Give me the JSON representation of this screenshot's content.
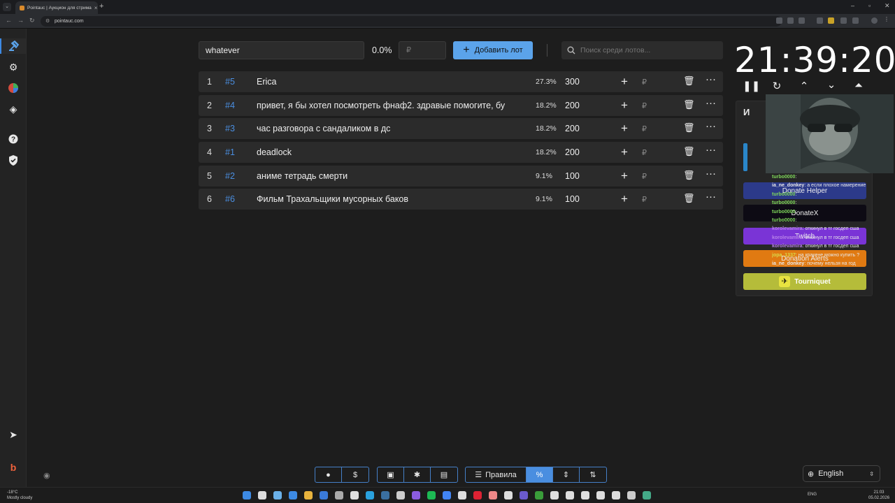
{
  "browser": {
    "tab_title": "Pointauc | Аукцион для стрима",
    "url": "pointauc.com"
  },
  "colors": {
    "accent": "#5ba3ea",
    "id_link": "#4a8ee0",
    "background": "#1d1d1d",
    "row_background": "#2b2b2b"
  },
  "sidebar": {
    "items": [
      {
        "name": "auction-icon"
      },
      {
        "name": "settings-icon"
      },
      {
        "name": "wheel-icon"
      },
      {
        "name": "layers-icon"
      },
      {
        "name": "help-icon"
      },
      {
        "name": "shield-check-icon"
      },
      {
        "name": "telegram-icon"
      },
      {
        "name": "boosty-icon"
      }
    ]
  },
  "lot_form": {
    "name_value": "whatever",
    "percent": "0.0%",
    "amount_placeholder": "₽",
    "add_button_label": "Добавить лот",
    "search_placeholder": "Поиск среди лотов..."
  },
  "lots": [
    {
      "index": "1",
      "id": "#5",
      "name": "Erica",
      "percent": "27.3%",
      "amount": "300",
      "currency": "₽"
    },
    {
      "index": "2",
      "id": "#4",
      "name": "привет, я бы хотел посмотреть фнаф2. здравые помогите, бу",
      "percent": "18.2%",
      "amount": "200",
      "currency": "₽"
    },
    {
      "index": "3",
      "id": "#3",
      "name": "час разговора с сандаликом в дс",
      "percent": "18.2%",
      "amount": "200",
      "currency": "₽"
    },
    {
      "index": "4",
      "id": "#1",
      "name": "deadlock",
      "percent": "18.2%",
      "amount": "200",
      "currency": "₽"
    },
    {
      "index": "5",
      "id": "#2",
      "name": "аниме тетрадь смерти",
      "percent": "9.1%",
      "amount": "100",
      "currency": "₽"
    },
    {
      "index": "6",
      "id": "#6",
      "name": "Фильм Трахальщики мусорных баков",
      "percent": "9.1%",
      "amount": "100",
      "currency": "₽"
    }
  ],
  "timer": {
    "display": "21:39:20"
  },
  "integrations": {
    "header_letter": "И",
    "buttons": [
      {
        "label": "Donate Helper",
        "color": "#2c3a8a"
      },
      {
        "label": "DonateX",
        "color": "#0d0b14"
      },
      {
        "label": "Twitch",
        "color": "#7a34d6"
      },
      {
        "label": "Donation Alerts",
        "color": "#e07a12"
      },
      {
        "label": "Tourniquet",
        "color": "#b5bc3a"
      }
    ]
  },
  "chat": [
    {
      "user": "turbo0000",
      "text": "",
      "color": "#7fd85b"
    },
    {
      "user": "ia_ne_donkey",
      "text": "а если плохое намерение",
      "color": "#e8e8e8"
    },
    {
      "user": "turbo0000",
      "text": "",
      "color": "#7fd85b"
    },
    {
      "user": "turbo0000",
      "text": "",
      "color": "#7fd85b"
    },
    {
      "user": "turbo0000",
      "text": "",
      "color": "#7fd85b"
    },
    {
      "user": "turbo0000",
      "text": "",
      "color": "#7fd85b"
    },
    {
      "user": "korolevamira",
      "text": "откинул в тг госдеп сша",
      "color": "#b783e8"
    },
    {
      "user": "korolevamira",
      "text": "откинул в тг госдеп сша",
      "color": "#b783e8"
    },
    {
      "user": "korolevamira",
      "text": "откинул в тг госдеп сша",
      "color": "#b783e8"
    },
    {
      "user": "jopa_1337",
      "text": "на кракене можно купить ?",
      "color": "#d8d84a"
    },
    {
      "user": "ia_ne_donkey",
      "text": "почему нельзя на год",
      "color": "#e8e8e8"
    }
  ],
  "bottom_toolbar": {
    "rules_label": "Правила"
  },
  "language": {
    "selected": "English"
  },
  "taskbar": {
    "temperature": "-18°C",
    "weather": "Mostly cloudy",
    "keyboard_lang": "ENG",
    "time": "21:03",
    "date": "05.02.2026"
  }
}
